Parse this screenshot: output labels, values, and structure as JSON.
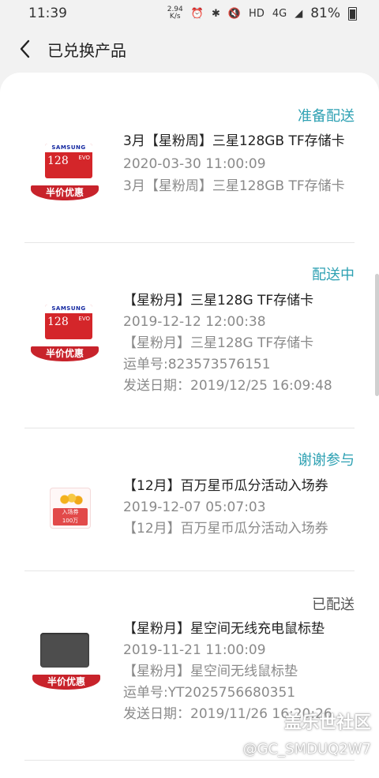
{
  "status_bar": {
    "time": "11:39",
    "net_speed_value": "2.94",
    "net_speed_unit": "K/s",
    "network": "4G",
    "hd": "HD",
    "battery": "81%"
  },
  "header": {
    "title": "已兑换产品"
  },
  "items": [
    {
      "status": "准备配送",
      "name": "3月【星粉周】三星128GB TF存储卡",
      "date": "2020-03-30 11:00:09",
      "desc": "3月【星粉周】三星128GB TF存储卡",
      "badge": "半价优惠",
      "thumb_brand": "SAMSUNG",
      "thumb_capacity": "128",
      "thumb_sub": "EVO"
    },
    {
      "status": "配送中",
      "name": "【星粉月】三星128G TF存储卡",
      "date": "2019-12-12 12:00:38",
      "desc": "【星粉月】三星128G TF存储卡",
      "tracking": "运单号:823573576151",
      "ship_date": "发送日期：2019/12/25 16:09:48",
      "badge": "半价优惠",
      "thumb_brand": "SAMSUNG",
      "thumb_capacity": "128",
      "thumb_sub": "EVO"
    },
    {
      "status": "谢谢参与",
      "name": "【12月】百万星币瓜分活动入场券",
      "date": "2019-12-07 05:07:03",
      "desc": "【12月】百万星币瓜分活动入场券",
      "ticket_label": "入场券",
      "ticket_value": "100万"
    },
    {
      "status": "已配送",
      "name": "【星粉月】星空间无线充电鼠标垫",
      "date": "2019-11-21 11:00:09",
      "desc": "【星粉月】星空间无线鼠标垫",
      "tracking": "运单号:YT2025756680351",
      "ship_date": "发送日期：2019/11/26 16:20:26",
      "badge": "半价优惠"
    }
  ],
  "watermark": {
    "logo": "盖乐世社区",
    "user": "@GC_SMDUQ2W7"
  },
  "icons": {
    "back": "chevron-left-icon"
  }
}
